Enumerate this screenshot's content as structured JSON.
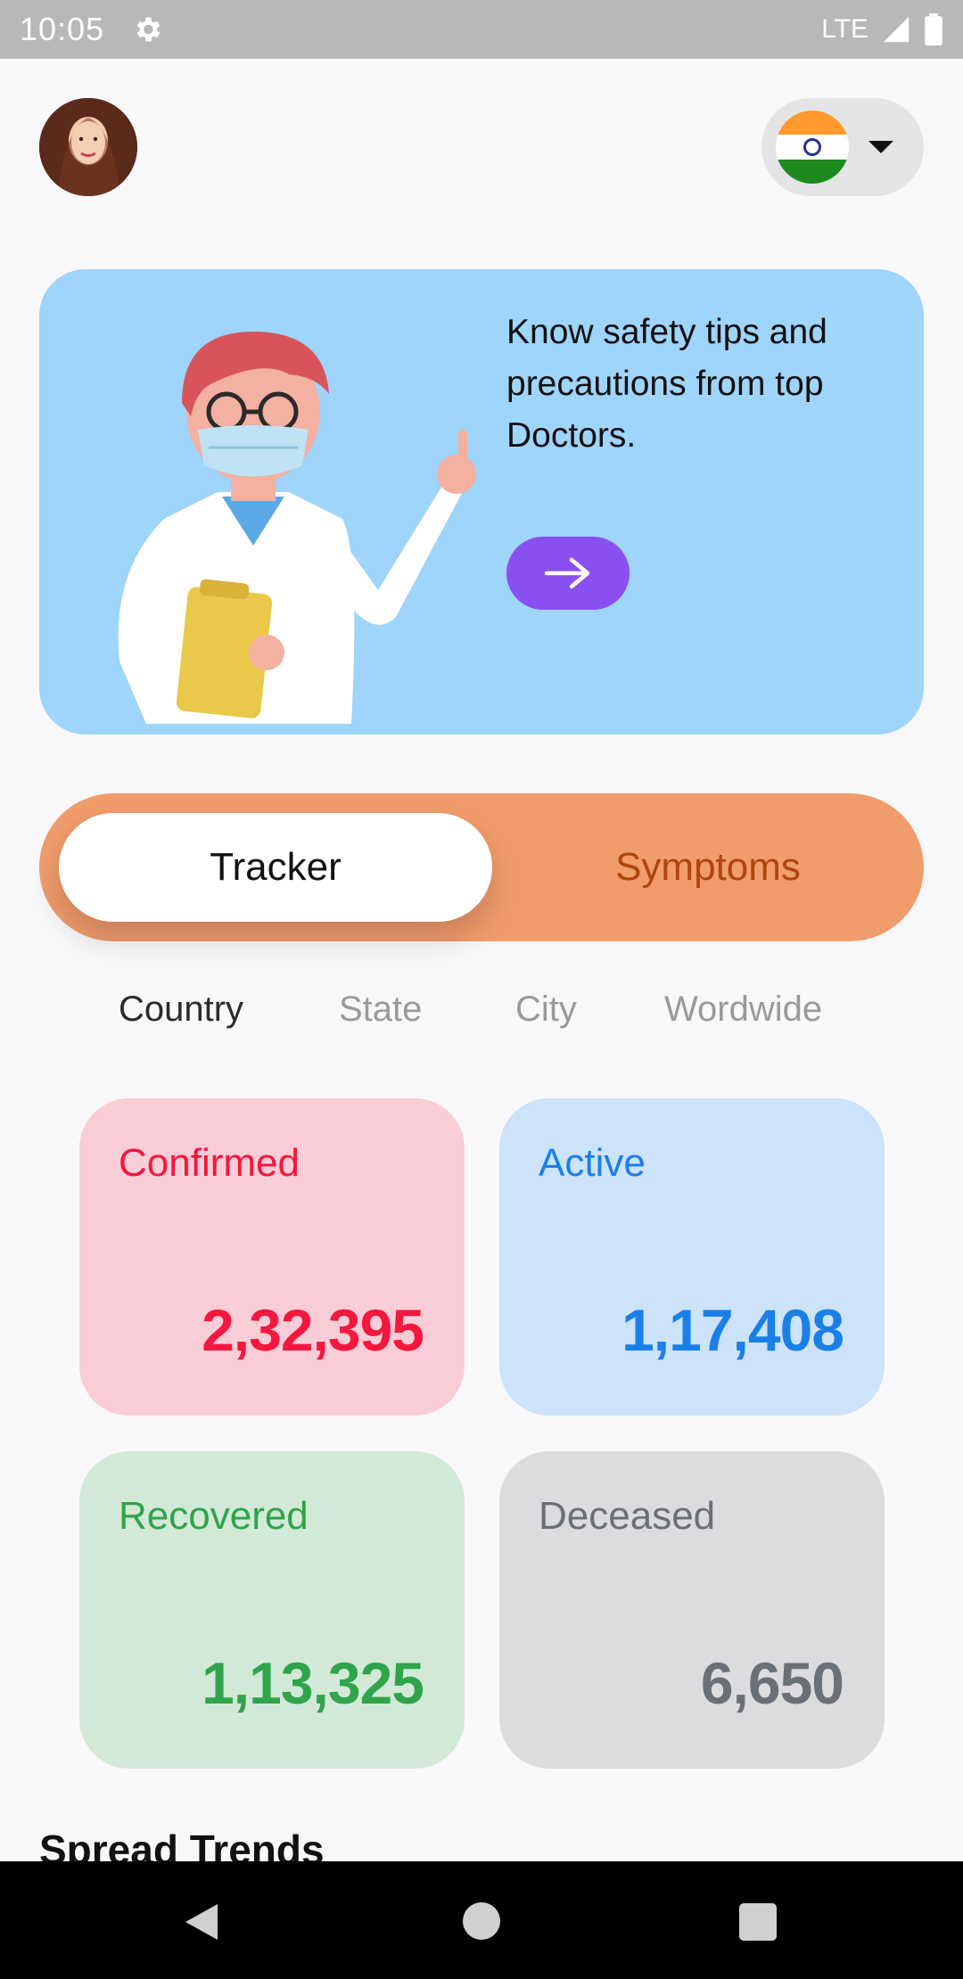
{
  "status_bar": {
    "time": "10:05",
    "network": "LTE",
    "icons": [
      "settings-gear-icon",
      "signal-icon",
      "battery-icon"
    ]
  },
  "header": {
    "avatar": "user-avatar",
    "country_flag": "india-flag-icon"
  },
  "banner": {
    "text": "Know safety tips and precautions from top Doctors.",
    "button_icon": "arrow-right-icon",
    "illustration": "doctor-illustration"
  },
  "segmented": {
    "tracker_label": "Tracker",
    "symptoms_label": "Symptoms",
    "selected": "Tracker"
  },
  "scope_tabs": {
    "country": "Country",
    "state": "State",
    "city": "City",
    "worldwide": "Wordwide",
    "selected": "Country"
  },
  "stats": {
    "confirmed": {
      "label": "Confirmed",
      "value": "2,32,395",
      "color": "#f4173f"
    },
    "active": {
      "label": "Active",
      "value": "1,17,408",
      "color": "#1b7fe8"
    },
    "recovered": {
      "label": "Recovered",
      "value": "1,13,325",
      "color": "#2fa44b"
    },
    "deceased": {
      "label": "Deceased",
      "value": "6,650",
      "color": "#6b6f76"
    }
  },
  "section": {
    "title": "Spread Trends"
  },
  "colors": {
    "banner_bg": "#9fd4fb",
    "accent_purple": "#8a4ff0",
    "segment_orange": "#f19c6b"
  }
}
